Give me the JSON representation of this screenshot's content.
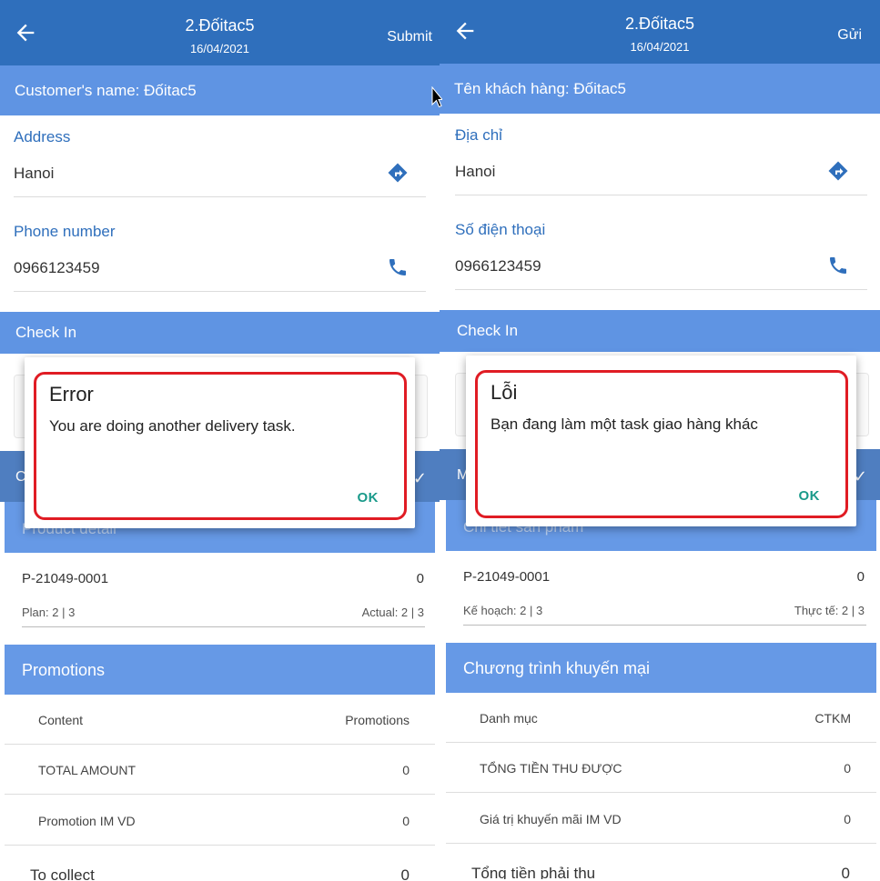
{
  "left": {
    "header": {
      "title": "2.Đốitac5",
      "date": "16/04/2021",
      "action": "Submit"
    },
    "customer_banner": "Customer's name: Đốitac5",
    "address": {
      "label": "Address",
      "value": "Hanoi"
    },
    "phone": {
      "label": "Phone number",
      "value": "0966123459"
    },
    "checkin": "Check In",
    "strip_letter": "C",
    "product": {
      "banner": "Product detail",
      "code": "P-21049-0001",
      "code_value": "0",
      "plan": "Plan: 2 | 3",
      "actual": "Actual: 2 | 3"
    },
    "promotions": {
      "banner": "Promotions",
      "header": {
        "c1": "Content",
        "c2": "Promotions"
      },
      "rows": [
        {
          "c1": "TOTAL AMOUNT",
          "c2": "0"
        },
        {
          "c1": "Promotion IM VD",
          "c2": "0"
        }
      ]
    },
    "collect": {
      "label": "To collect",
      "value": "0"
    },
    "dialog": {
      "title": "Error",
      "message": "You are doing another delivery task.",
      "ok": "OK"
    }
  },
  "right": {
    "header": {
      "title": "2.Đốitac5",
      "date": "16/04/2021",
      "action": "Gửi"
    },
    "customer_banner": "Tên khách hàng: Đốitac5",
    "address": {
      "label": "Địa chỉ",
      "value": "Hanoi"
    },
    "phone": {
      "label": "Số điện thoại",
      "value": "0966123459"
    },
    "checkin": "Check In",
    "strip_letter": "M",
    "product": {
      "banner": "Chi tiết sản phẩm",
      "code": "P-21049-0001",
      "code_value": "0",
      "plan": "Kế hoạch: 2 | 3",
      "actual": "Thực tế: 2 | 3"
    },
    "promotions": {
      "banner": "Chương trình khuyến mại",
      "header": {
        "c1": "Danh mục",
        "c2": "CTKM"
      },
      "rows": [
        {
          "c1": "TỔNG TIỀN THU ĐƯỢC",
          "c2": "0"
        },
        {
          "c1": "Giá trị khuyến mãi IM VD",
          "c2": "0"
        }
      ]
    },
    "collect": {
      "label": "Tổng tiền phải thu",
      "value": "0"
    },
    "dialog": {
      "title": "Lỗi",
      "message": "Bạn đang làm một task giao hàng khác",
      "ok": "OK"
    }
  },
  "colors": {
    "header": "#2f6fbc",
    "banner": "#5f94e3",
    "highlight": "#e01c24",
    "ok": "#1a9a8a"
  }
}
